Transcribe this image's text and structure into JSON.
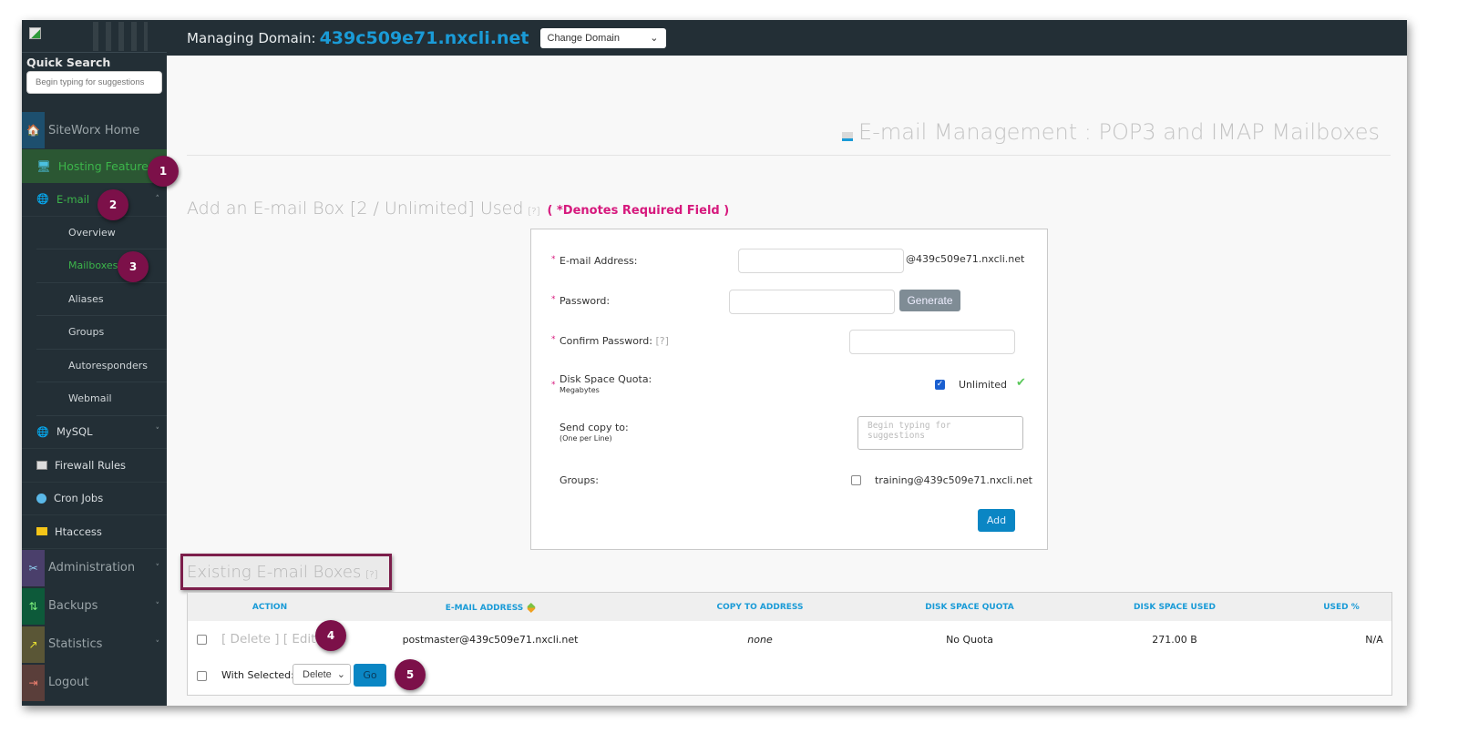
{
  "sidebar": {
    "quick_search_label": "Quick Search",
    "quick_search_placeholder": "Begin typing for suggestions",
    "items": [
      {
        "label": "SiteWorx Home",
        "icon": "home-icon",
        "color": "#1d4f6e"
      },
      {
        "label": "Hosting Features",
        "icon": "monitor-icon"
      },
      {
        "label": "E-mail",
        "icon": "email-icon"
      },
      {
        "label": "MySQL",
        "icon": "database-icon"
      },
      {
        "label": "Firewall Rules",
        "icon": "terminal-icon"
      },
      {
        "label": "Cron Jobs",
        "icon": "clock-icon"
      },
      {
        "label": "Htaccess",
        "icon": "folder-icon"
      },
      {
        "label": "Administration",
        "icon": "tools-icon",
        "color": "#4a3f6b"
      },
      {
        "label": "Backups",
        "icon": "backup-arrows-icon",
        "color": "#0d5a3a"
      },
      {
        "label": "Statistics",
        "icon": "chart-icon",
        "color": "#5a5636"
      },
      {
        "label": "Logout",
        "icon": "logout-icon",
        "color": "#5a3e3a"
      }
    ],
    "email_subitems": [
      "Overview",
      "Mailboxes",
      "Aliases",
      "Groups",
      "Autoresponders",
      "Webmail"
    ]
  },
  "header": {
    "managing_label": "Managing Domain:",
    "domain": "439c509e71.nxcli.net",
    "change_domain": "Change Domain"
  },
  "page": {
    "title": "E-mail Management : POP3 and IMAP Mailboxes",
    "add_heading": "Add an E-mail Box [2 / Unlimited] Used",
    "help": "[?]",
    "required_note": "( *Denotes Required Field )",
    "form": {
      "email_label": "E-mail Address:",
      "email_suffix": "@439c509e71.nxcli.net",
      "password_label": "Password:",
      "generate": "Generate",
      "confirm_label": "Confirm Password:",
      "quota_label": "Disk Space Quota:",
      "quota_sub": "Megabytes",
      "unlimited": "Unlimited",
      "copy_label": "Send copy to:",
      "copy_sub": "(One per Line)",
      "copy_placeholder": "Begin typing for suggestions",
      "groups_label": "Groups:",
      "group_option": "training@439c509e71.nxcli.net",
      "add": "Add"
    },
    "existing_heading": "Existing E-mail Boxes",
    "table": {
      "headers": [
        "ACTION",
        "E-MAIL ADDRESS",
        "COPY TO ADDRESS",
        "DISK SPACE QUOTA",
        "DISK SPACE USED",
        "USED %"
      ],
      "rows": [
        {
          "actions": "[ Delete ] [ Edit ]",
          "email": "postmaster@439c509e71.nxcli.net",
          "copy_to": "none",
          "quota": "No Quota",
          "used": "271.00 B",
          "used_pct": "N/A"
        }
      ],
      "with_selected": "With Selected:",
      "bulk_option": "Delete",
      "go": "Go"
    }
  },
  "annotations": [
    "1",
    "2",
    "3",
    "4",
    "5"
  ]
}
